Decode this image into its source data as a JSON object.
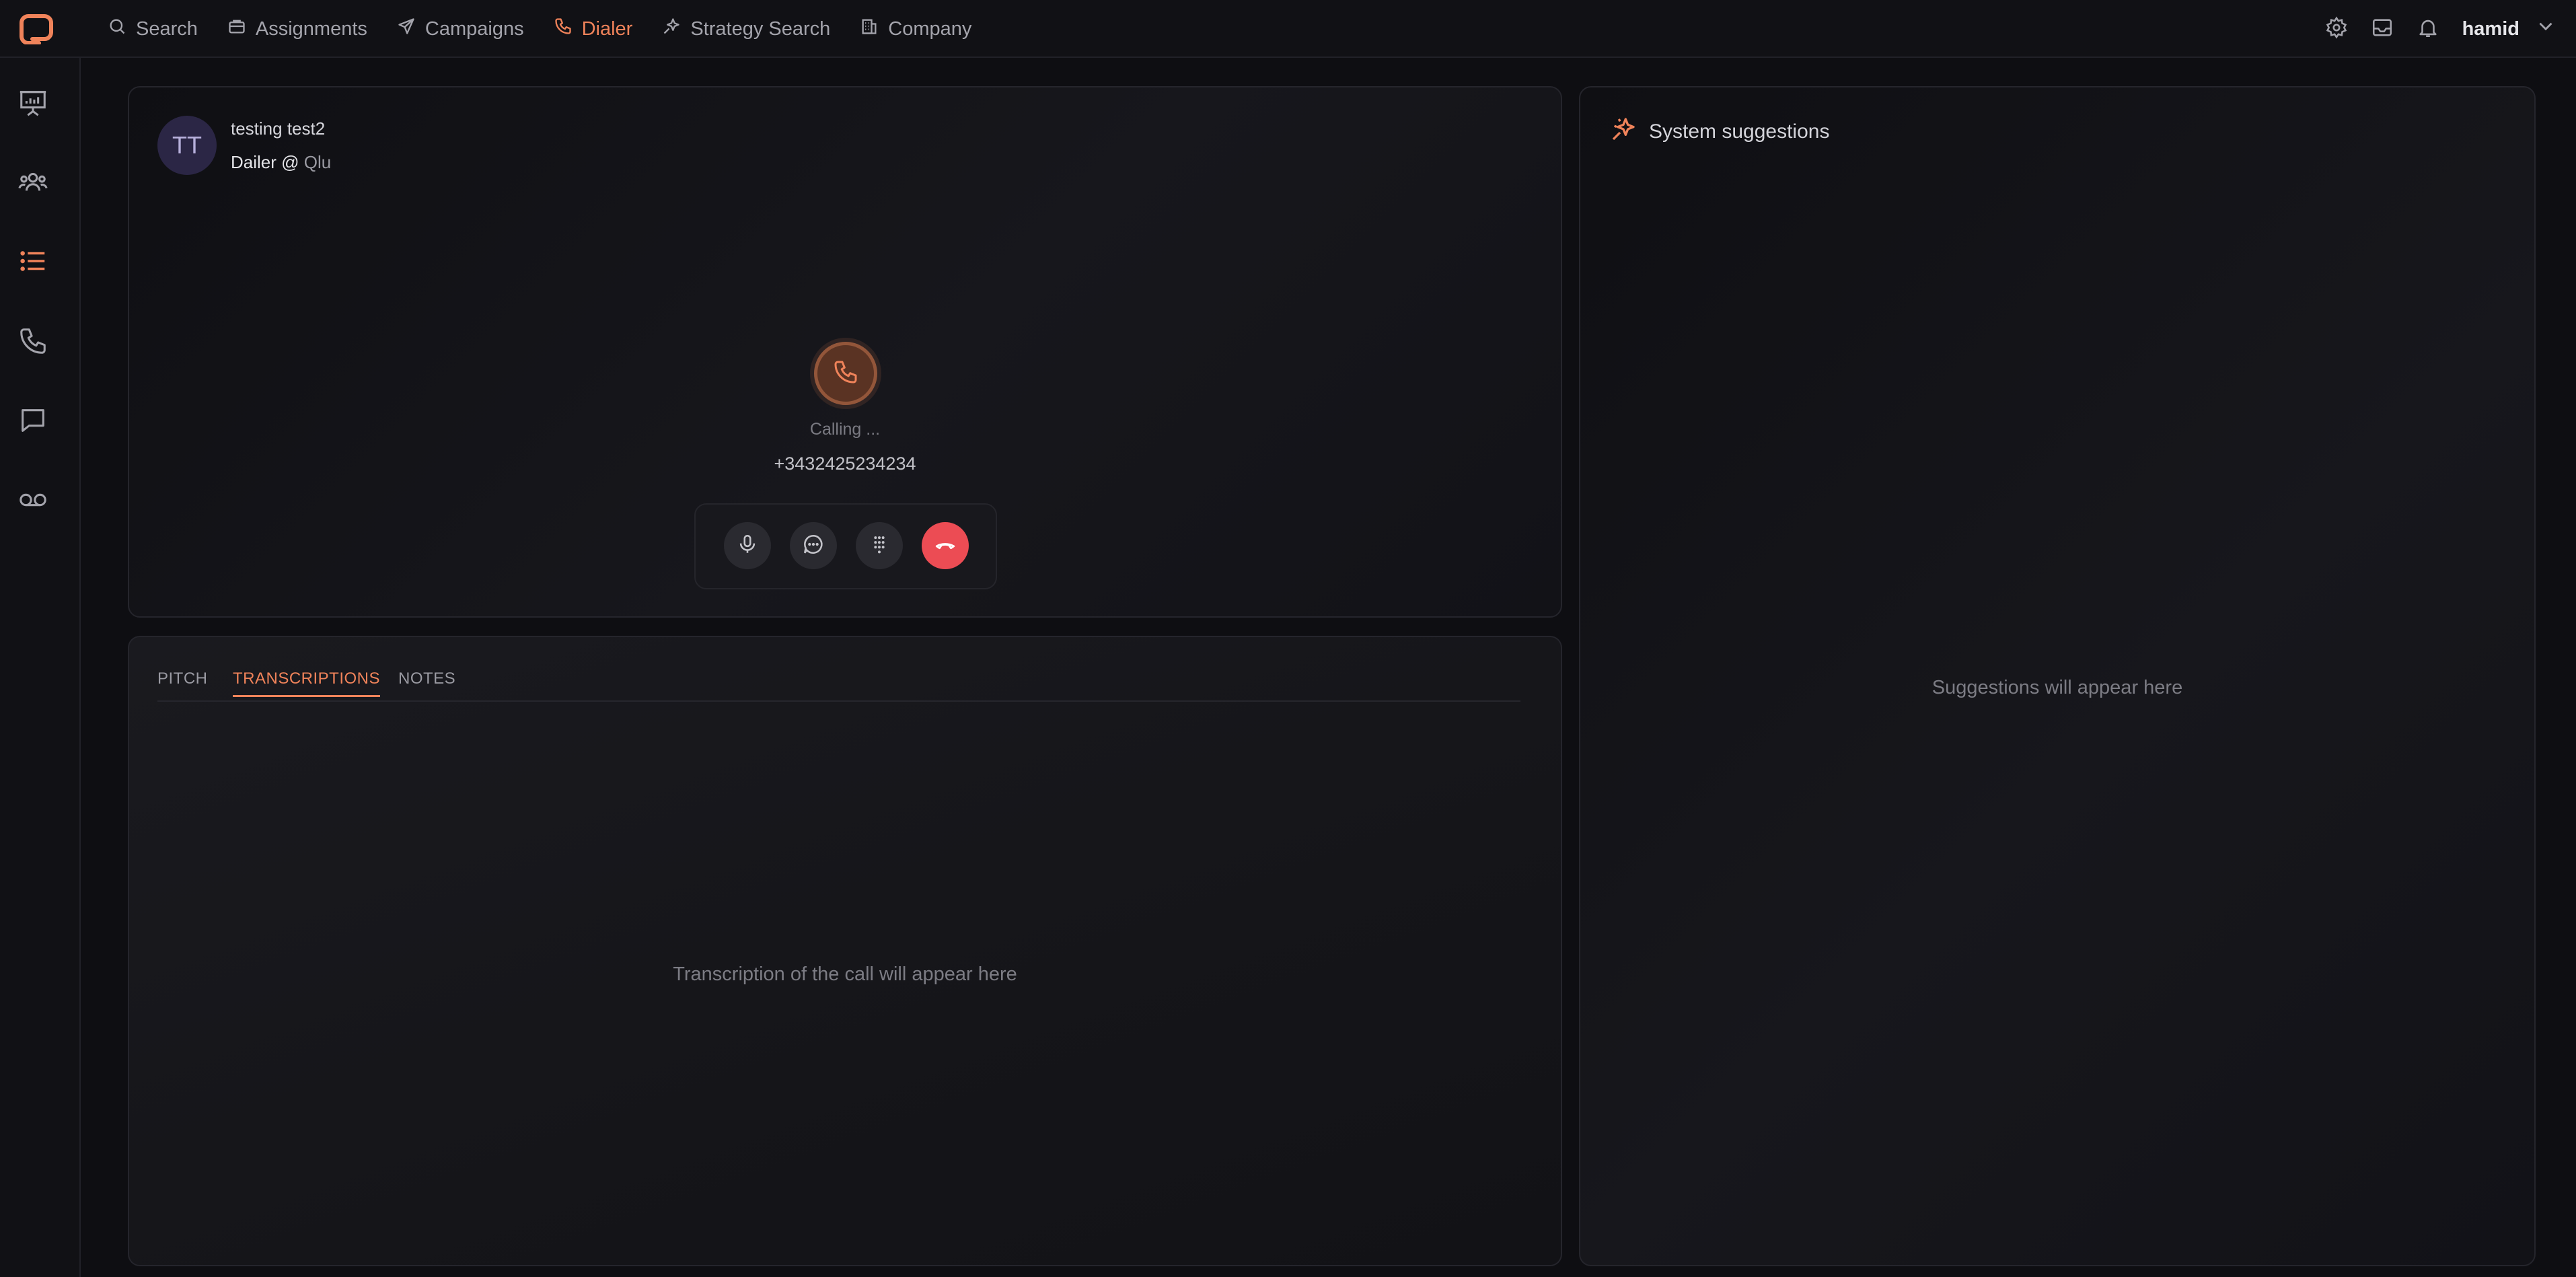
{
  "nav": {
    "items": [
      {
        "label": "Search",
        "icon": "search-icon"
      },
      {
        "label": "Assignments",
        "icon": "briefcase-icon"
      },
      {
        "label": "Campaigns",
        "icon": "send-icon"
      },
      {
        "label": "Dialer",
        "icon": "phone-icon",
        "active": true
      },
      {
        "label": "Strategy Search",
        "icon": "sparkle-icon"
      },
      {
        "label": "Company",
        "icon": "building-icon"
      }
    ],
    "user_name": "hamid"
  },
  "caller": {
    "initials": "TT",
    "name": "testing test2",
    "role": "Dailer @",
    "company": "Qlu",
    "status": "Calling ...",
    "phone": "+3432425234234"
  },
  "tabs": [
    "PITCH",
    "TRANSCRIPTIONS",
    "NOTES"
  ],
  "active_tab": "TRANSCRIPTIONS",
  "transcription_empty": "Transcription of the call will appear here",
  "suggestions": {
    "title": "System suggestions",
    "empty": "Suggestions will appear here"
  },
  "colors": {
    "accent": "#f0835a",
    "end_call": "#ec4c54",
    "background": "#0e0e12"
  }
}
